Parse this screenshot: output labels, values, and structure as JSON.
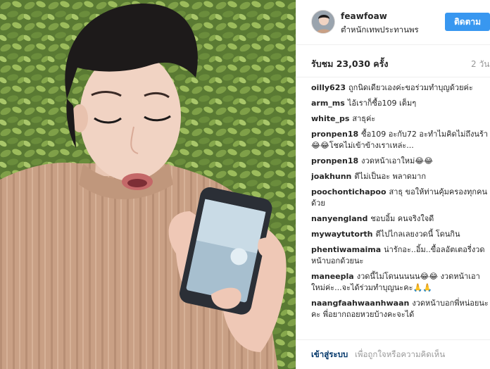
{
  "post": {
    "username": "feawfoaw",
    "location": "ตำหนักเทพประทานพร",
    "follow_label": "ติดตาม",
    "views": "รับชม 23,030 ครั้ง",
    "time": "2 วัน"
  },
  "comments": [
    {
      "user": "oilly623",
      "text": "ถูกนิดเดียวเองค่ะขอร่วมทำบุญด้วยค่ะ"
    },
    {
      "user": "arm_ms",
      "text": "ไอ้เราก็ซื้อ109 เต็มๆ"
    },
    {
      "user": "white_ps",
      "text": "สาธุค่ะ"
    },
    {
      "user": "pronpen18",
      "text": "ซื้อ109 อะกับ72 อะทำไมคิดไม่ถึงนร้า😂😂โชคไม่เข้าข้างเราเหล่ะ..."
    },
    {
      "user": "pronpen18",
      "text": "งวดหน้าเอาใหม่😂😂"
    },
    {
      "user": "joakhunn",
      "text": "ตีไม่เป็นอะ พลาดมาก"
    },
    {
      "user": "poochontichapoo",
      "text": "สาธุ ขอให้ท่านคุ้มครองทุกคนด้วย"
    },
    {
      "user": "nanyengland",
      "text": "ชอบอิ้ม คนจริงใจดี"
    },
    {
      "user": "mywaytutorth",
      "text": "ตีไปไกลเลยงวดนี้ โดนกิน"
    },
    {
      "user": "phentiwamaima",
      "text": "น่ารักอะ..อิ้ม..ขื้อลอัตเตอรี่งวดหน้าบอกด้วยนะ"
    },
    {
      "user": "maneepla",
      "text": "งวดนี้ไม่โดนนนนน😂😂 งวดหน้าเอาใหม่ค่ะ...จะได้ร่วมทำบุญนะคะ🙏🙏"
    },
    {
      "user": "naangfaahwaanhwaan",
      "text": "งวดหน้าบอกพี่หน่อยนะคะ พี่อยากถอยหวยบ้างคะจะได้"
    }
  ],
  "footer": {
    "login_label": "เข้าสู่ระบบ",
    "login_hint": "เพื่อถูกใจหรือความคิดเห็น"
  },
  "colors": {
    "accent": "#3897f0",
    "link": "#003569",
    "muted": "#999999",
    "divider": "#efefef"
  },
  "icons": {
    "photo": "woman-holding-phone-photo"
  }
}
